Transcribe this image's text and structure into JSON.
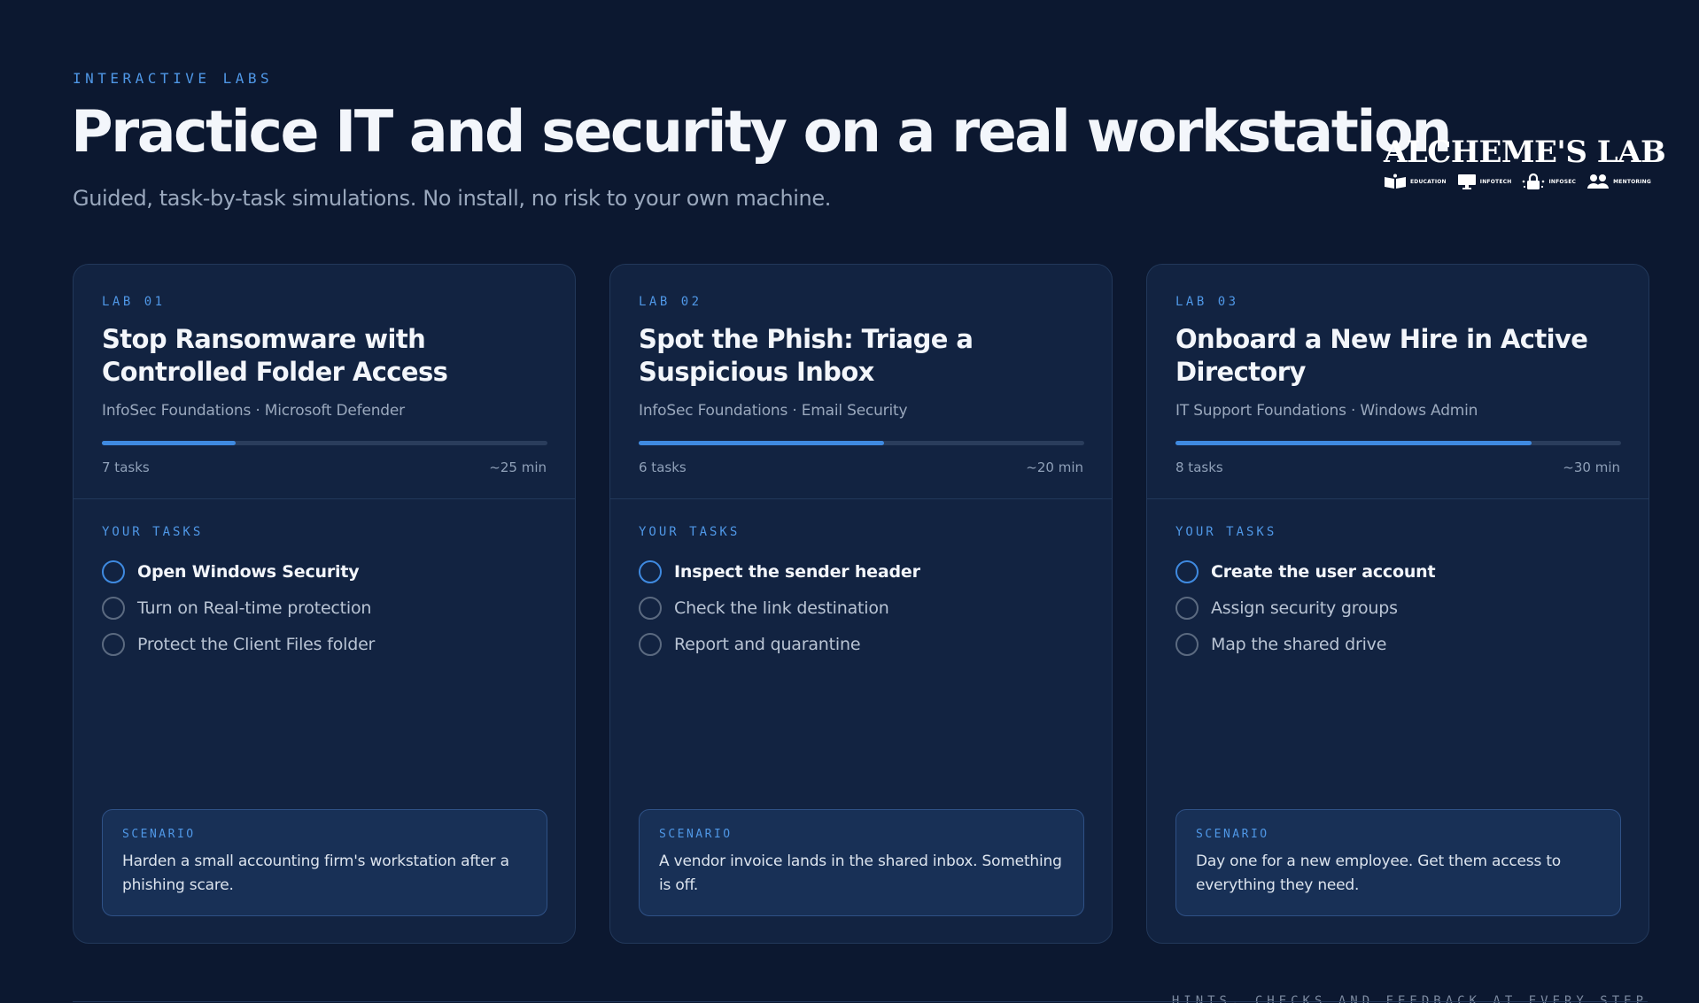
{
  "header": {
    "eyebrow": "INTERACTIVE LABS",
    "title": "Practice IT and security on a real workstation",
    "subtitle": "Guided, task-by-task simulations. No install, no risk to your own machine."
  },
  "logo": {
    "wordmark": "ALCHEME'S LAB",
    "items": [
      {
        "icon": "book-icon",
        "label": "EDUCATION"
      },
      {
        "icon": "monitor-icon",
        "label": "INFOTECH"
      },
      {
        "icon": "lock-icon",
        "label": "INFOSEC"
      },
      {
        "icon": "people-icon",
        "label": "MENTORING"
      }
    ]
  },
  "colors": {
    "background": "#0c1830",
    "card": "#122341",
    "accent": "#3f8ae0",
    "accent_text": "#4f97e6",
    "scenario_bg": "#183056"
  },
  "labs": [
    {
      "number": "LAB 01",
      "title": "Stop Ransomware with Controlled Folder Access",
      "meta": "InfoSec Foundations · Microsoft Defender",
      "progress": 0.3,
      "tasks_count": "7 tasks",
      "duration": "~25 min",
      "tasks_label": "YOUR TASKS",
      "tasks": [
        "Open Windows Security",
        "Turn on Real-time protection",
        "Protect the Client Files folder"
      ],
      "scenario_label": "SCENARIO",
      "scenario": "Harden a small accounting firm's workstation after a phishing scare."
    },
    {
      "number": "LAB 02",
      "title": "Spot the Phish: Triage a Suspicious Inbox",
      "meta": "InfoSec Foundations · Email Security",
      "progress": 0.55,
      "tasks_count": "6 tasks",
      "duration": "~20 min",
      "tasks_label": "YOUR TASKS",
      "tasks": [
        "Inspect the sender header",
        "Check the link destination",
        "Report and quarantine"
      ],
      "scenario_label": "SCENARIO",
      "scenario": "A vendor invoice lands in the shared inbox. Something is off."
    },
    {
      "number": "LAB 03",
      "title": "Onboard a New Hire in Active Directory",
      "meta": "IT Support Foundations · Windows Admin",
      "progress": 0.8,
      "tasks_count": "8 tasks",
      "duration": "~30 min",
      "tasks_label": "YOUR TASKS",
      "tasks": [
        "Create the user account",
        "Assign security groups",
        "Map the shared drive"
      ],
      "scenario_label": "SCENARIO",
      "scenario": "Day one for a new employee. Get them access to everything they need."
    }
  ],
  "footer": {
    "note": "HINTS, CHECKS AND FEEDBACK AT EVERY STEP"
  }
}
